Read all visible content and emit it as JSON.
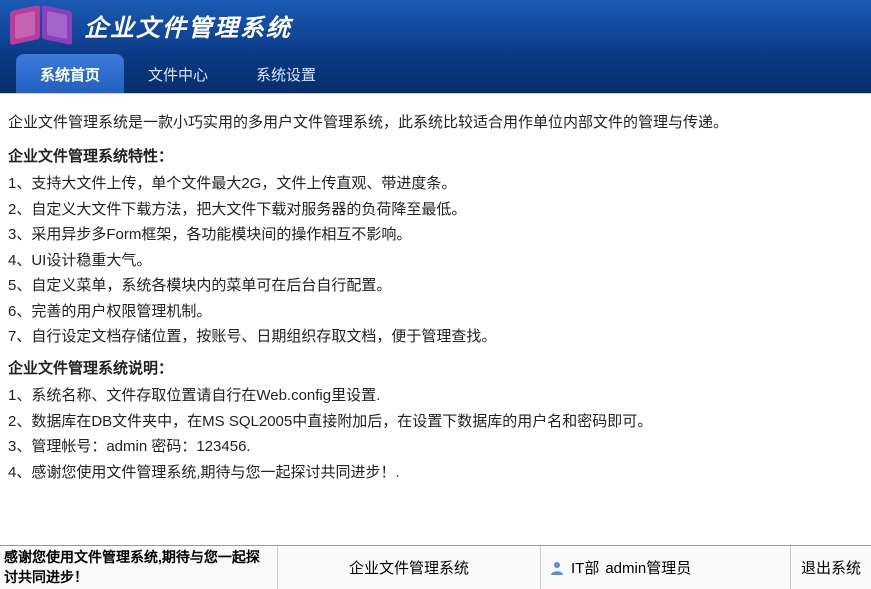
{
  "header": {
    "app_title": "企业文件管理系统"
  },
  "nav": {
    "tabs": [
      {
        "label": "系统首页",
        "active": true
      },
      {
        "label": "文件中心",
        "active": false
      },
      {
        "label": "系统设置",
        "active": false
      }
    ]
  },
  "content": {
    "intro": "企业文件管理系统是一款小巧实用的多用户文件管理系统，此系统比较适合用作单位内部文件的管理与传递。",
    "features_title": "企业文件管理系统特性：",
    "features": [
      "1、支持大文件上传，单个文件最大2G，文件上传直观、带进度条。",
      "2、自定义大文件下载方法，把大文件下载对服务器的负荷降至最低。",
      "3、采用异步多Form框架，各功能模块间的操作相互不影响。",
      "4、UI设计稳重大气。",
      "5、自定义菜单，系统各模块内的菜单可在后台自行配置。",
      "6、完善的用户权限管理机制。",
      "7、自行设定文档存储位置，按账号、日期组织存取文档，便于管理查找。"
    ],
    "notes_title": "企业文件管理系统说明：",
    "notes": [
      "1、系统名称、文件存取位置请自行在Web.config里设置.",
      "2、数据库在DB文件夹中，在MS SQL2005中直接附加后，在设置下数据库的用户名和密码即可。",
      "3、管理帐号：admin 密码：123456.",
      "4、感谢您使用文件管理系统,期待与您一起探讨共同进步！."
    ]
  },
  "footer": {
    "message": "感谢您使用文件管理系统,期待与您一起探讨共同进步！",
    "center_text": "企业文件管理系统",
    "user_dept": "IT部",
    "user_name": "admin管理员",
    "logout_label": "退出系统"
  }
}
